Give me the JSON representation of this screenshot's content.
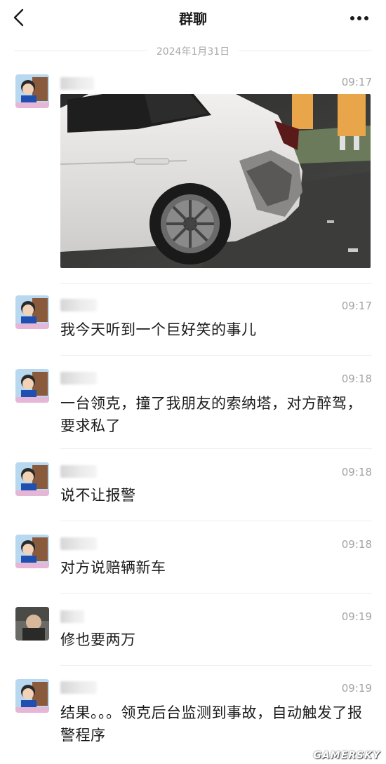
{
  "header": {
    "title": "群聊",
    "back_icon": "chevron-left-icon",
    "more_icon": "more-dots-icon"
  },
  "date_separator": "2024年1月31日",
  "messages": [
    {
      "time": "09:17",
      "type": "image"
    },
    {
      "time": "09:17",
      "text": "我今天听到一个巨好笑的事儿"
    },
    {
      "time": "09:18",
      "text": "一台领克，撞了我朋友的索纳塔，对方醉驾，要求私了"
    },
    {
      "time": "09:18",
      "text": "说不让报警"
    },
    {
      "time": "09:18",
      "text": "对方说赔辆新车"
    },
    {
      "time": "09:19",
      "text": "修也要两万"
    },
    {
      "time": "09:19",
      "text": "结果。。。领克后台监测到事故，自动触发了报警程序"
    }
  ],
  "watermark": "GAMERSKY"
}
